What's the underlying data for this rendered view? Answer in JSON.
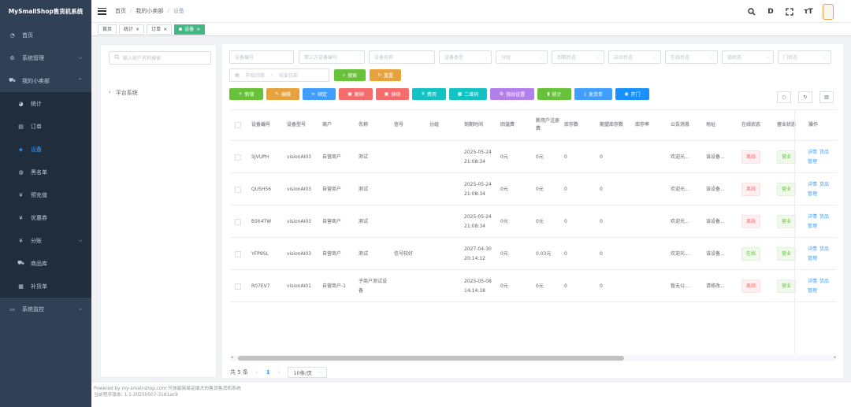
{
  "app": {
    "title": "MySmallShop售货机系统"
  },
  "sidebar": {
    "items": [
      {
        "label": "首页",
        "icon": "dashboard-icon"
      },
      {
        "label": "系统管理",
        "icon": "gear-icon"
      },
      {
        "label": "我的小卖部",
        "icon": "cart-icon"
      },
      {
        "label": "统计",
        "icon": "chart-icon"
      },
      {
        "label": "订单",
        "icon": "document-icon"
      },
      {
        "label": "设备",
        "icon": "device-icon"
      },
      {
        "label": "黑名单",
        "icon": "blacklist-icon"
      },
      {
        "label": "预充值",
        "icon": "yen-icon"
      },
      {
        "label": "优惠券",
        "icon": "yen-icon"
      },
      {
        "label": "分账",
        "icon": "yen-icon"
      },
      {
        "label": "商品库",
        "icon": "cart-icon"
      },
      {
        "label": "补货单",
        "icon": "table-icon"
      },
      {
        "label": "系统监控",
        "icon": "monitor-icon"
      }
    ]
  },
  "breadcrumb": {
    "items": [
      "首页",
      "我的小卖部",
      "设备"
    ]
  },
  "toolbar_icons": [
    "search-icon",
    "d-icon",
    "fullscreen-icon",
    "font-size-icon"
  ],
  "tags": [
    "首页",
    "统计",
    "订单",
    "设备"
  ],
  "tree": {
    "search_placeholder": "输入商户名称搜索",
    "root": "平台系统"
  },
  "filters": {
    "device_no": "设备编号",
    "third_no": "第三方设备编号",
    "device_name": "设备名称",
    "device_type": "设备类型",
    "group": "分组",
    "expire_status": "到期状态",
    "start_status": "启动状态",
    "online_status": "在线状态",
    "lock_status": "锁状态",
    "door_status": "门状态",
    "start_date": "开始日期",
    "end_date": "结束日期",
    "date_sep": "-",
    "search": "搜索",
    "reset": "重置"
  },
  "actions": [
    "新增",
    "编辑",
    "绑定",
    "解绑",
    "换绑",
    "费用",
    "二维码",
    "指纹设置",
    "统计",
    "发货单",
    "开门"
  ],
  "table": {
    "headers": [
      "设备编号",
      "设备型号",
      "商户",
      "名称",
      "信号",
      "分组",
      "到期时间",
      "回温费",
      "新用户注册费",
      "库存数",
      "期望库存数",
      "库存率",
      "公告消息",
      "地址",
      "在线状态",
      "营业状态",
      "操作"
    ],
    "rows": [
      {
        "no": "5JVUPH",
        "model": "visionAI03",
        "merchant": "自营商户",
        "name": "测试",
        "signal": "",
        "group": "",
        "expire": "2025-05-24 21:08:34",
        "f1": "0元",
        "f2": "0元",
        "stock": "0",
        "expect": "0",
        "rate": "",
        "notice": "欢迎光...",
        "addr": "该设备...",
        "online": "离线",
        "biz": "营业"
      },
      {
        "no": "QU5H56",
        "model": "visionAI03",
        "merchant": "自营商户",
        "name": "测试",
        "signal": "",
        "group": "",
        "expire": "2025-05-24 21:08:34",
        "f1": "0元",
        "f2": "0元",
        "stock": "0",
        "expect": "0",
        "rate": "",
        "notice": "欢迎光...",
        "addr": "该设备...",
        "online": "离线",
        "biz": "营业"
      },
      {
        "no": "B564TW",
        "model": "visionAI03",
        "merchant": "自营商户",
        "name": "测试",
        "signal": "",
        "group": "",
        "expire": "2025-05-24 21:08:34",
        "f1": "0元",
        "f2": "0元",
        "stock": "0",
        "expect": "0",
        "rate": "",
        "notice": "欢迎光...",
        "addr": "该设备...",
        "online": "离线",
        "biz": "营业"
      },
      {
        "no": "YFP9SL",
        "model": "visionAI03",
        "merchant": "自营商户",
        "name": "测试",
        "signal": "信号较好",
        "group": "",
        "expire": "2027-04-30 20:14:12",
        "f1": "0元",
        "f2": "0.03元",
        "stock": "0",
        "expect": "0",
        "rate": "",
        "notice": "欢迎光...",
        "addr": "该设备...",
        "online": "在线",
        "biz": "营业"
      },
      {
        "no": "R07EV7",
        "model": "visionAI01",
        "merchant": "自营商户-1",
        "name": "子商户测试设备",
        "signal": "",
        "group": "",
        "expire": "2025-05-08 14:14:18",
        "f1": "0元",
        "f2": "0元",
        "stock": "0",
        "expect": "0",
        "rate": "",
        "notice": "暂无公...",
        "addr": "请修改...",
        "online": "离线",
        "biz": "营业"
      }
    ],
    "ops": [
      "详情",
      "货品",
      "管理"
    ]
  },
  "pager": {
    "total": "共 5 条",
    "page": "1",
    "size": "10条/页"
  },
  "footer": {
    "line1": "Powered by my-small-shop.com 开放最简易定撬大的售货售货机系统",
    "line2": "当前程序版本: 1.1-20250507-3181ac9"
  }
}
